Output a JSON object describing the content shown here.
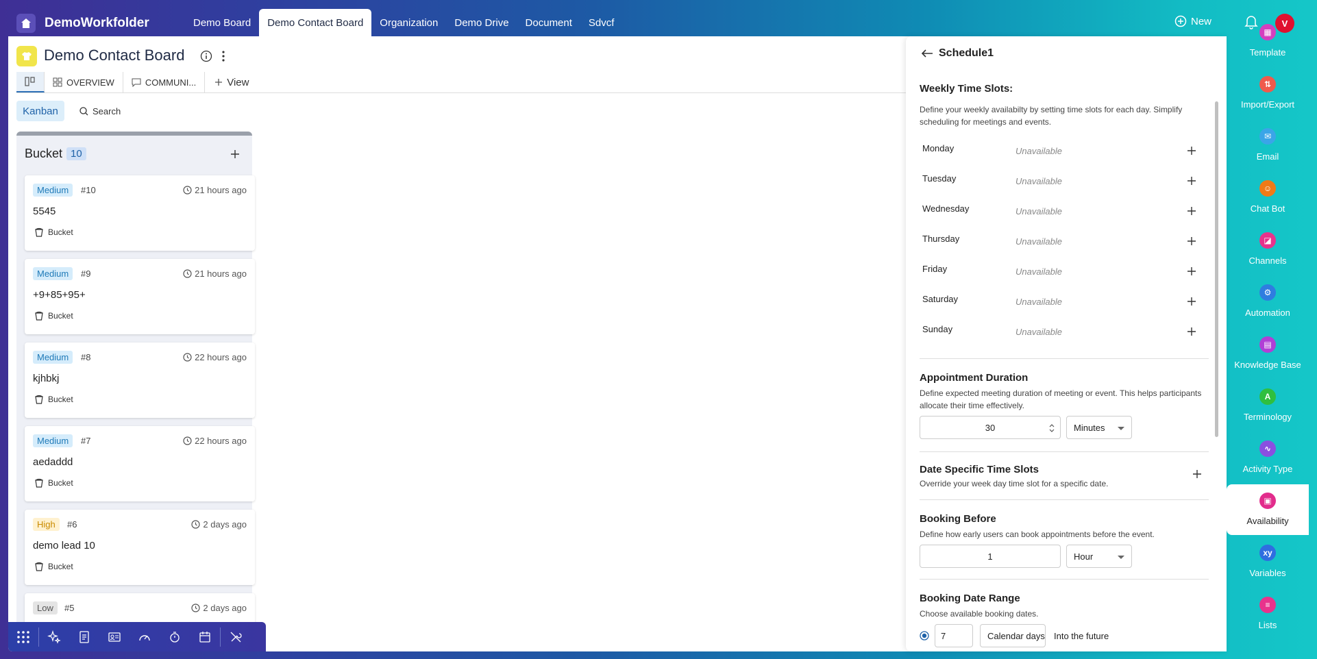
{
  "app": {
    "brand": "DemoWorkfolder"
  },
  "topnav": {
    "tabs": [
      {
        "label": "Demo Board"
      },
      {
        "label": "Demo Contact Board"
      },
      {
        "label": "Organization"
      },
      {
        "label": "Demo Drive"
      },
      {
        "label": "Document"
      },
      {
        "label": "Sdvcf"
      }
    ],
    "active_index": 1,
    "new_label": "New",
    "avatar_letter": "V"
  },
  "board": {
    "title": "Demo Contact Board",
    "view_tabs": [
      {
        "label": "OVERVIEW"
      },
      {
        "label": "COMMUNI..."
      }
    ],
    "add_view_label": "View",
    "kanban_label": "Kanban",
    "search_label": "Search"
  },
  "column": {
    "title": "Bucket",
    "count": "10",
    "cards": [
      {
        "priority": "Medium",
        "num": "#10",
        "time": "21 hours ago",
        "title": "5545",
        "bucket": "Bucket"
      },
      {
        "priority": "Medium",
        "num": "#9",
        "time": "21 hours ago",
        "title": "+9+85+95+",
        "bucket": "Bucket"
      },
      {
        "priority": "Medium",
        "num": "#8",
        "time": "22 hours ago",
        "title": "kjhbkj",
        "bucket": "Bucket"
      },
      {
        "priority": "Medium",
        "num": "#7",
        "time": "22 hours ago",
        "title": "aedaddd",
        "bucket": "Bucket"
      },
      {
        "priority": "High",
        "num": "#6",
        "time": "2 days ago",
        "title": "demo lead 10",
        "bucket": "Bucket"
      },
      {
        "priority": "Low",
        "num": "#5",
        "time": "2 days ago",
        "title": "",
        "bucket": ""
      }
    ]
  },
  "panel": {
    "title": "Schedule1",
    "weekly": {
      "title": "Weekly Time Slots:",
      "desc": "Define your weekly availabilty by setting time slots for each day. Simplify scheduling for meetings and events.",
      "days": [
        {
          "name": "Monday",
          "status": "Unavailable"
        },
        {
          "name": "Tuesday",
          "status": "Unavailable"
        },
        {
          "name": "Wednesday",
          "status": "Unavailable"
        },
        {
          "name": "Thursday",
          "status": "Unavailable"
        },
        {
          "name": "Friday",
          "status": "Unavailable"
        },
        {
          "name": "Saturday",
          "status": "Unavailable"
        },
        {
          "name": "Sunday",
          "status": "Unavailable"
        }
      ]
    },
    "duration": {
      "title": "Appointment Duration",
      "desc": "Define expected meeting duration of meeting or event. This helps participants allocate their time effectively.",
      "value": "30",
      "unit": "Minutes"
    },
    "date_specific": {
      "title": "Date Specific Time Slots",
      "desc": "Override your week day time slot for a specific date."
    },
    "booking_before": {
      "title": "Booking Before",
      "desc": "Define how early users can book appointments before the event.",
      "value": "1",
      "unit": "Hour"
    },
    "date_range": {
      "title": "Booking Date Range",
      "desc": "Choose available booking dates.",
      "value": "7",
      "unit": "Calendar days",
      "suffix": "Into the future"
    }
  },
  "rightbar": {
    "items": [
      {
        "label": "Template",
        "color": "#d43fbf"
      },
      {
        "label": "Import/Export",
        "color": "#ef5a4c"
      },
      {
        "label": "Email",
        "color": "#3aa5e8"
      },
      {
        "label": "Chat Bot",
        "color": "#f07a17"
      },
      {
        "label": "Channels",
        "color": "#e8338c"
      },
      {
        "label": "Automation",
        "color": "#2f7de0"
      },
      {
        "label": "Knowledge Base",
        "color": "#b03fd6"
      },
      {
        "label": "Terminology",
        "color": "#2fbf3f"
      },
      {
        "label": "Activity Type",
        "color": "#8a4fe0"
      },
      {
        "label": "Availability",
        "color": "#e22c8c"
      },
      {
        "label": "Variables",
        "color": "#2f6ee0"
      },
      {
        "label": "Lists",
        "color": "#e8338c"
      }
    ],
    "active_index": 9
  }
}
